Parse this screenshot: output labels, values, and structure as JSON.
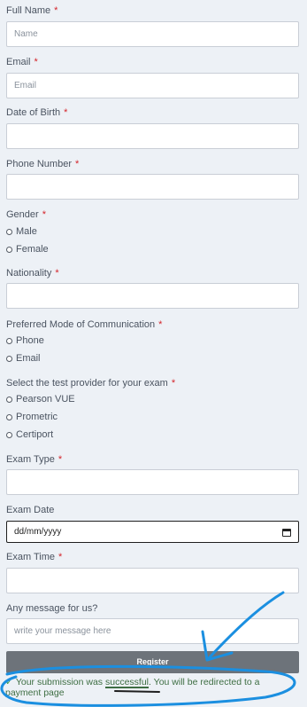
{
  "form": {
    "full_name": {
      "label": "Full Name",
      "placeholder": "Name"
    },
    "email": {
      "label": "Email",
      "placeholder": "Email"
    },
    "dob": {
      "label": "Date of Birth"
    },
    "phone": {
      "label": "Phone Number"
    },
    "gender": {
      "label": "Gender",
      "options": [
        "Male",
        "Female"
      ]
    },
    "nationality": {
      "label": "Nationality"
    },
    "communication": {
      "label": "Preferred Mode of Communication",
      "options": [
        "Phone",
        "Email"
      ]
    },
    "provider": {
      "label": "Select the test provider for your exam",
      "options": [
        "Pearson VUE",
        "Prometric",
        "Certiport"
      ]
    },
    "exam_type": {
      "label": "Exam Type"
    },
    "exam_date": {
      "label": "Exam Date",
      "value": "dd/mm/yyyy"
    },
    "exam_time": {
      "label": "Exam Time"
    },
    "message": {
      "label": "Any message for us?",
      "placeholder": "write your message here"
    },
    "required_mark": "*",
    "register_label": "Register"
  },
  "status": {
    "check_symbol": "✓",
    "text_before": "Your submission was ",
    "highlight": "successful",
    "text_after": ". You will be redirected to a payment page"
  },
  "colors": {
    "background": "#edf1f6",
    "required": "#d4242a",
    "register_button": "#6d737a",
    "annotation": "#1b8fe0",
    "success_text": "#3e6e43"
  }
}
